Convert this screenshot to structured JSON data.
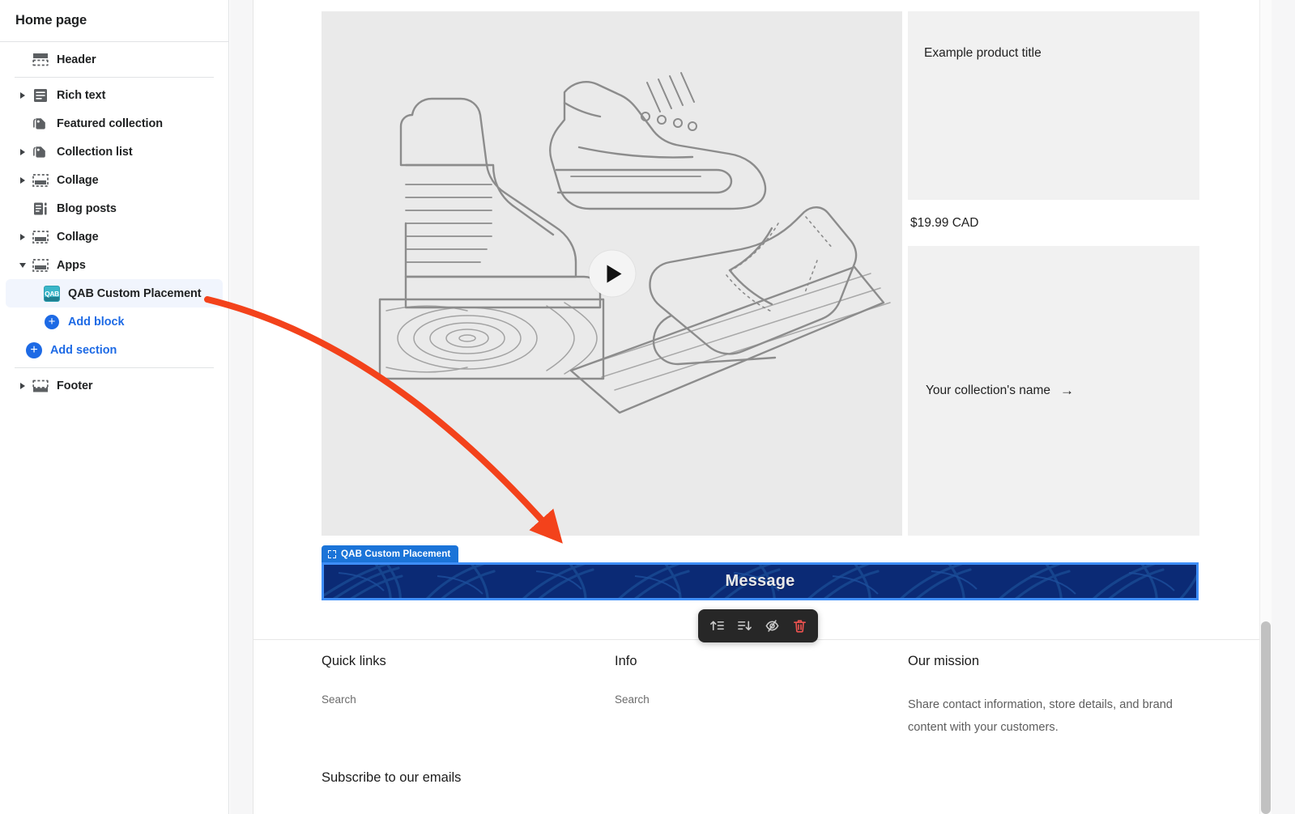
{
  "sidebar": {
    "title": "Home page",
    "items": [
      {
        "label": "Header",
        "icon": "section-icon",
        "expandable": false,
        "expanded": false,
        "indent": 0
      },
      {
        "label": "Rich text",
        "icon": "rich-text-icon",
        "expandable": true,
        "expanded": false,
        "indent": 0
      },
      {
        "label": "Featured collection",
        "icon": "collection-icon",
        "expandable": false,
        "expanded": false,
        "indent": 0
      },
      {
        "label": "Collection list",
        "icon": "collection-icon",
        "expandable": true,
        "expanded": false,
        "indent": 0
      },
      {
        "label": "Collage",
        "icon": "section-icon",
        "expandable": true,
        "expanded": false,
        "indent": 0
      },
      {
        "label": "Blog posts",
        "icon": "blog-icon",
        "expandable": false,
        "expanded": false,
        "indent": 0
      },
      {
        "label": "Collage",
        "icon": "section-icon",
        "expandable": true,
        "expanded": false,
        "indent": 0
      },
      {
        "label": "Apps",
        "icon": "section-icon",
        "expandable": true,
        "expanded": true,
        "indent": 0
      }
    ],
    "selected_child": {
      "label": "QAB Custom Placement",
      "icon": "qab-app-icon",
      "badge_text": "QAB"
    },
    "add_block_label": "Add block",
    "add_section_label": "Add section",
    "footer_item": {
      "label": "Footer",
      "icon": "section-icon",
      "expandable": true
    }
  },
  "preview": {
    "media": {
      "play_icon": "play-icon"
    },
    "product": {
      "title": "Example product title",
      "price": "$19.99 CAD"
    },
    "collection": {
      "name": "Your collection's name",
      "arrow": "→"
    },
    "app_block": {
      "tag_label": "QAB Custom Placement",
      "tag_icon": "crop-corners-icon",
      "banner_text": "Message",
      "selection_color": "#3e8ef7",
      "banner_bg": "#0b2a75",
      "tag_bg": "#1b74d8"
    },
    "toolbar": {
      "buttons": [
        {
          "name": "move-block-up-button",
          "icon": "arrow-up-to-line-icon",
          "color": "#c9c9c9"
        },
        {
          "name": "move-block-down-button",
          "icon": "arrow-down-to-line-icon",
          "color": "#c9c9c9"
        },
        {
          "name": "hide-block-button",
          "icon": "eye-slash-icon",
          "color": "#c9c9c9"
        },
        {
          "name": "delete-block-button",
          "icon": "trash-icon",
          "color": "#ef5350"
        }
      ]
    },
    "footer": {
      "columns": [
        {
          "heading": "Quick links",
          "links": [
            "Search"
          ]
        },
        {
          "heading": "Info",
          "links": [
            "Search"
          ]
        }
      ],
      "mission_heading": "Our mission",
      "mission_body": "Share contact information, store details, and brand content with your customers.",
      "subscribe_heading": "Subscribe to our emails"
    }
  },
  "annotation": {
    "color": "#f3421b",
    "description": "curved-arrow-from-sidebar-block-to-preview-block"
  }
}
